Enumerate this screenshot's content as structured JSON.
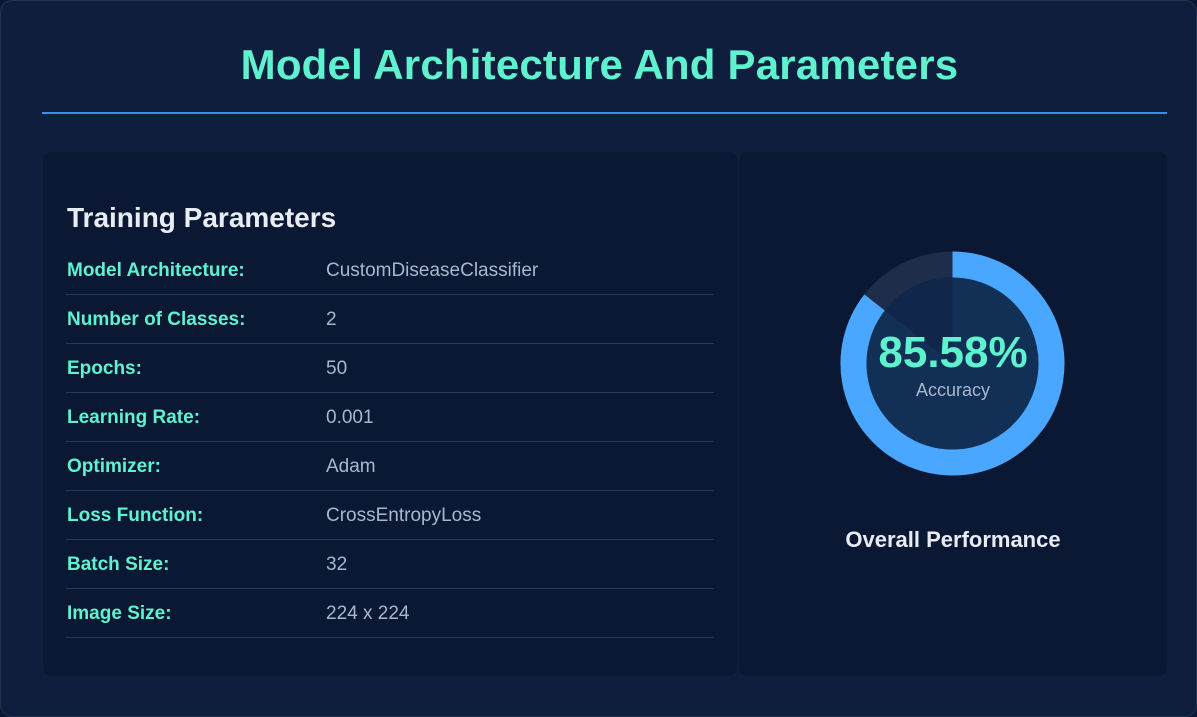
{
  "header": {
    "title": "Model Architecture And Parameters"
  },
  "training_parameters": {
    "title": "Training Parameters",
    "rows": [
      {
        "label": "Model Architecture:",
        "value": "CustomDiseaseClassifier"
      },
      {
        "label": "Number of Classes:",
        "value": "2"
      },
      {
        "label": "Epochs:",
        "value": "50"
      },
      {
        "label": "Learning Rate:",
        "value": "0.001"
      },
      {
        "label": "Optimizer:",
        "value": "Adam"
      },
      {
        "label": "Loss Function:",
        "value": "CrossEntropyLoss"
      },
      {
        "label": "Batch Size:",
        "value": "32"
      },
      {
        "label": "Image Size:",
        "value": "224 x 224"
      }
    ]
  },
  "performance": {
    "title": "Overall Performance",
    "accuracy_text": "85.58%",
    "accuracy_fraction": 0.8558,
    "caption": "Accuracy"
  },
  "colors": {
    "accent_teal": "#5ef2cf",
    "ring_blue": "#4aa7ff",
    "ring_track": "#1d2d4a",
    "gauge_center": "#123056",
    "divider_blue": "#3a8df0"
  }
}
